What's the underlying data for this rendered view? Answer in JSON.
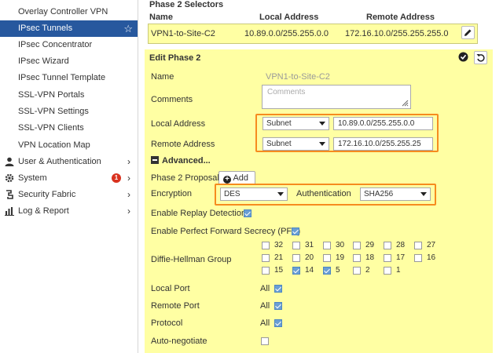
{
  "sidebar": {
    "items": [
      {
        "label": "Overlay Controller VPN"
      },
      {
        "label": "IPsec Tunnels"
      },
      {
        "label": "IPsec Concentrator"
      },
      {
        "label": "IPsec Wizard"
      },
      {
        "label": "IPsec Tunnel Template"
      },
      {
        "label": "SSL-VPN Portals"
      },
      {
        "label": "SSL-VPN Settings"
      },
      {
        "label": "SSL-VPN Clients"
      },
      {
        "label": "VPN Location Map"
      },
      {
        "label": "User & Authentication"
      },
      {
        "label": "System"
      },
      {
        "label": "Security Fabric"
      },
      {
        "label": "Log & Report"
      }
    ],
    "system_badge": "1"
  },
  "selectors": {
    "title": "Phase 2 Selectors",
    "col_name": "Name",
    "col_local": "Local Address",
    "col_remote": "Remote Address",
    "row": {
      "name": "VPN1-to-Site-C2",
      "local": "10.89.0.0/255.255.0.0",
      "remote": "172.16.10.0/255.255.255.0"
    }
  },
  "edit": {
    "title": "Edit Phase 2",
    "name_label": "Name",
    "name_value": "VPN1-to-Site-C2",
    "comments_label": "Comments",
    "comments_placeholder": "Comments",
    "local_label": "Local Address",
    "local_type": "Subnet",
    "local_value": "10.89.0.0/255.255.0.0",
    "remote_label": "Remote Address",
    "remote_type": "Subnet",
    "remote_value": "172.16.10.0/255.255.25",
    "advanced": "Advanced...",
    "proposal_label": "Phase 2 Proposal",
    "add_label": "Add",
    "encryption_label": "Encryption",
    "encryption_value": "DES",
    "authentication_label": "Authentication",
    "authentication_value": "SHA256",
    "replay_label": "Enable Replay Detection",
    "pfs_label": "Enable Perfect Forward Secrecy (PFS)",
    "dh_label": "Diffie-Hellman Group",
    "dh_row1": [
      {
        "label": "32",
        "checked": false
      },
      {
        "label": "31",
        "checked": false
      },
      {
        "label": "30",
        "checked": false
      },
      {
        "label": "29",
        "checked": false
      },
      {
        "label": "28",
        "checked": false
      },
      {
        "label": "27",
        "checked": false
      }
    ],
    "dh_row2": [
      {
        "label": "21",
        "checked": false
      },
      {
        "label": "20",
        "checked": false
      },
      {
        "label": "19",
        "checked": false
      },
      {
        "label": "18",
        "checked": false
      },
      {
        "label": "17",
        "checked": false
      },
      {
        "label": "16",
        "checked": false
      }
    ],
    "dh_row3": [
      {
        "label": "15",
        "checked": false
      },
      {
        "label": "14",
        "checked": true
      },
      {
        "label": "5",
        "checked": true
      },
      {
        "label": "2",
        "checked": false
      },
      {
        "label": "1",
        "checked": false
      }
    ],
    "local_port_label": "Local Port",
    "remote_port_label": "Remote Port",
    "protocol_label": "Protocol",
    "all_text": "All",
    "autoneg_label": "Auto-negotiate"
  }
}
